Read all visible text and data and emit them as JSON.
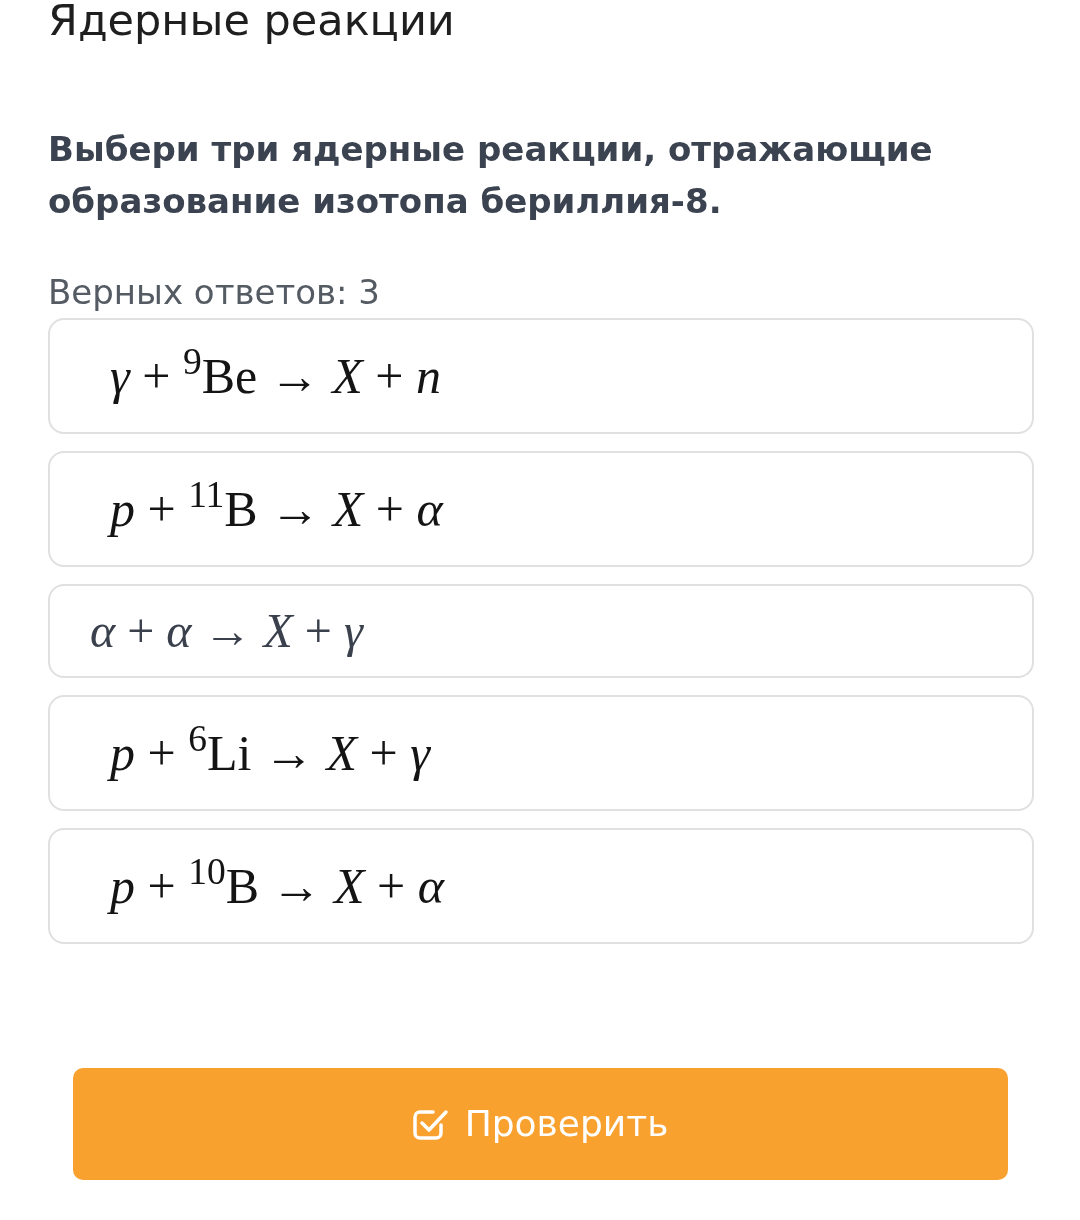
{
  "page_title": "Ядерные реакции",
  "question": "Выбери три ядерные реакции, отражающие образование изотопа бериллия-8.",
  "answer_count": "Верных ответов: 3",
  "options": [
    {
      "kind": "display",
      "formula": "*γ* + $^{9}$Be → *X* + *n*"
    },
    {
      "kind": "display",
      "formula": "*p* + $^{11}$B → *X* + *α*"
    },
    {
      "kind": "inline",
      "formula": "*α* + *α* → *X* + *γ*"
    },
    {
      "kind": "display",
      "formula": "*p* + $^{6}$Li → *X* + *γ*"
    },
    {
      "kind": "display",
      "formula": "*p* + $^{10}$B → *X* + *α*"
    }
  ],
  "check_button": {
    "label": "Проверить"
  }
}
